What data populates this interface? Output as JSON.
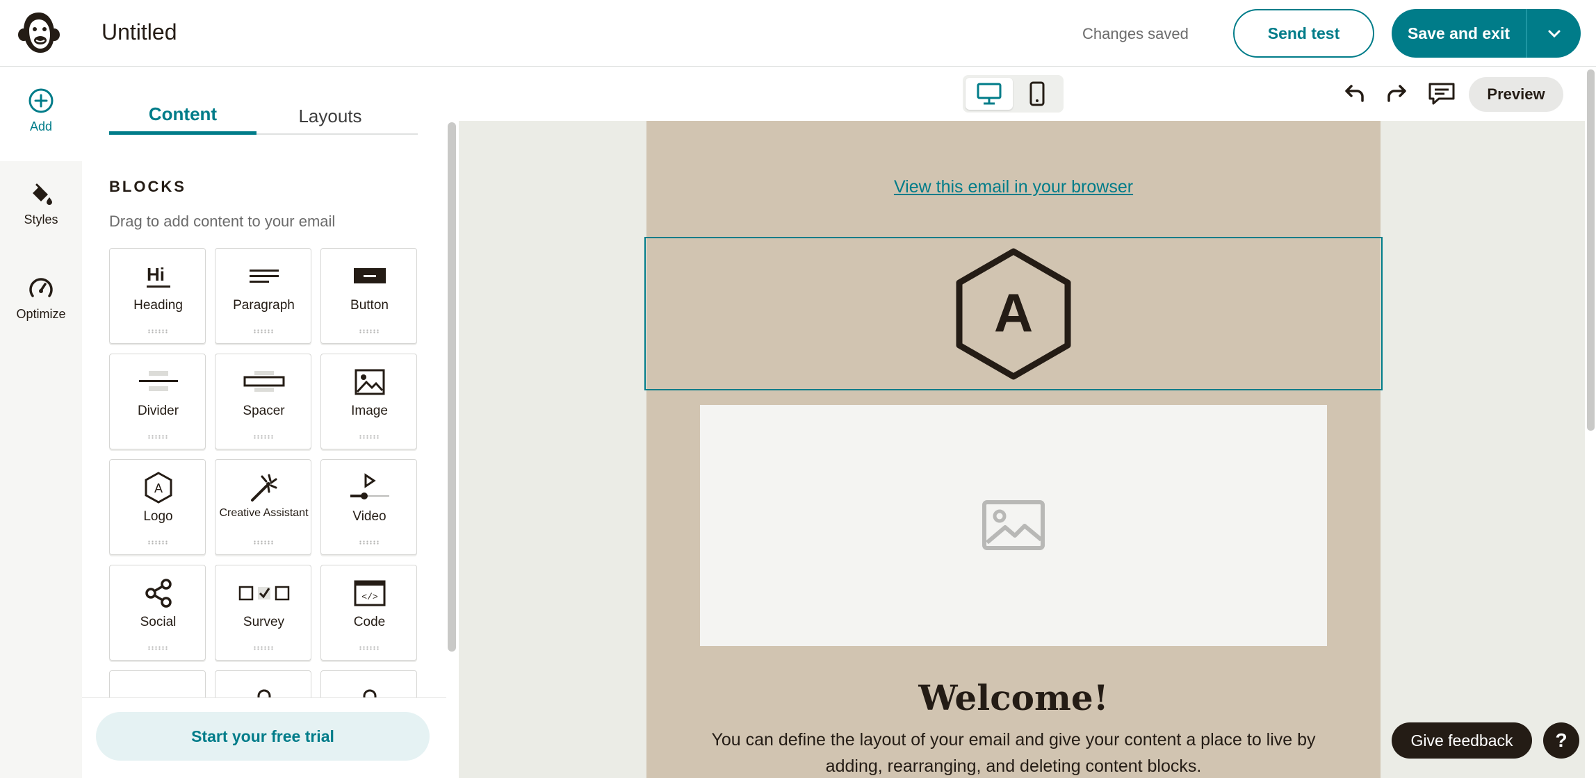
{
  "header": {
    "title": "Untitled",
    "status": "Changes saved",
    "send_test_label": "Send test",
    "save_exit_label": "Save and exit",
    "logo_icon": "freddie-monkey-icon"
  },
  "rail": {
    "items": [
      {
        "label": "Add",
        "icon": "plus-circle-icon"
      },
      {
        "label": "Styles",
        "icon": "paint-bucket-icon"
      },
      {
        "label": "Optimize",
        "icon": "gauge-icon"
      }
    ]
  },
  "panel": {
    "tabs": [
      {
        "label": "Content"
      },
      {
        "label": "Layouts"
      }
    ],
    "heading": "BLOCKS",
    "subheading": "Drag to add content to your email",
    "blocks": [
      {
        "label": "Heading"
      },
      {
        "label": "Paragraph"
      },
      {
        "label": "Button"
      },
      {
        "label": "Divider"
      },
      {
        "label": "Spacer"
      },
      {
        "label": "Image"
      },
      {
        "label": "Logo"
      },
      {
        "label": "Creative Assistant"
      },
      {
        "label": "Video"
      },
      {
        "label": "Social"
      },
      {
        "label": "Survey"
      },
      {
        "label": "Code"
      }
    ],
    "trial_label": "Start your free trial"
  },
  "canvas_toolbar": {
    "preview_label": "Preview"
  },
  "email": {
    "browser_link": "View this email in your browser",
    "logo_letter": "A",
    "welcome": "Welcome!",
    "body": "You can define the layout of your email and give your content a place to live by adding, rearranging, and deleting content blocks."
  },
  "footer": {
    "feedback_label": "Give feedback",
    "help_label": "?"
  },
  "colors": {
    "accent": "#007c89",
    "email_bg": "#d1c4b1",
    "canvas_bg": "#ebece6",
    "dark": "#241c15"
  }
}
